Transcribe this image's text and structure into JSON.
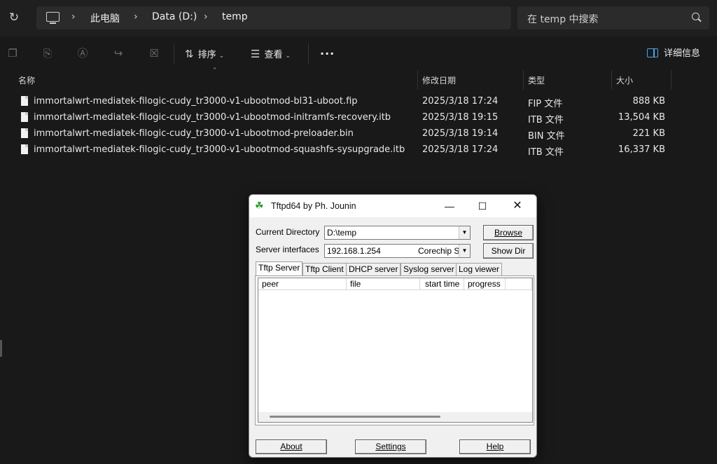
{
  "address_bar": {
    "crumbs": [
      "此电脑",
      "Data (D:)",
      "temp"
    ],
    "search_placeholder": "在 temp 中搜索"
  },
  "toolbar": {
    "sort_label": "排序",
    "view_label": "查看",
    "more_label": "···",
    "details_label": "详细信息"
  },
  "columns": {
    "name": "名称",
    "date": "修改日期",
    "type": "类型",
    "size": "大小"
  },
  "files": [
    {
      "name": "immortalwrt-mediatek-filogic-cudy_tr3000-v1-ubootmod-bl31-uboot.fip",
      "date": "2025/3/18 17:24",
      "type": "FIP 文件",
      "size": "888 KB"
    },
    {
      "name": "immortalwrt-mediatek-filogic-cudy_tr3000-v1-ubootmod-initramfs-recovery.itb",
      "date": "2025/3/18 19:15",
      "type": "ITB 文件",
      "size": "13,504 KB"
    },
    {
      "name": "immortalwrt-mediatek-filogic-cudy_tr3000-v1-ubootmod-preloader.bin",
      "date": "2025/3/18 19:14",
      "type": "BIN 文件",
      "size": "221 KB"
    },
    {
      "name": "immortalwrt-mediatek-filogic-cudy_tr3000-v1-ubootmod-squashfs-sysupgrade.itb",
      "date": "2025/3/18 17:24",
      "type": "ITB 文件",
      "size": "16,337 KB"
    }
  ],
  "tftpd": {
    "title": "Tftpd64 by Ph. Jounin",
    "current_dir_label": "Current Directory",
    "current_dir_value": "D:\\temp",
    "server_if_label": "Server interfaces",
    "server_if_ip": "192.168.1.254",
    "server_if_name": "Corechip S",
    "browse_label": "Browse",
    "showdir_label": "Show Dir",
    "tabs": [
      "Tftp Server",
      "Tftp Client",
      "DHCP server",
      "Syslog server",
      "Log viewer"
    ],
    "list_headers": [
      "peer",
      "file",
      "start time",
      "progress"
    ],
    "about_label": "About",
    "settings_label": "Settings",
    "help_label": "Help"
  }
}
